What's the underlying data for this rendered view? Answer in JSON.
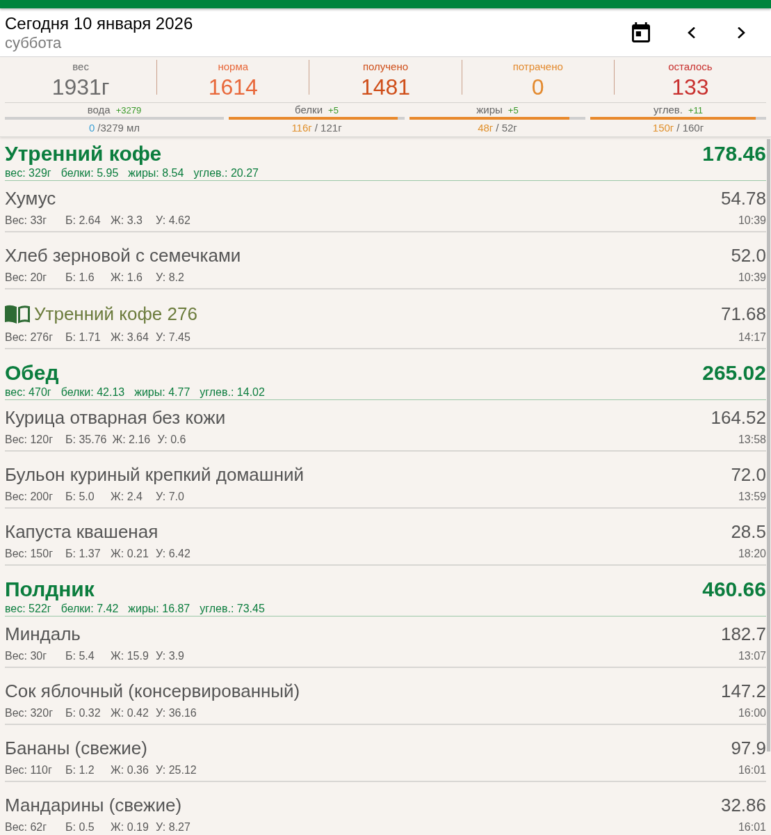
{
  "header": {
    "title": "Сегодня 10 января 2026",
    "weekday": "суббота"
  },
  "summary": [
    {
      "label": "вес",
      "value": "1931г",
      "color": "#6b6b6b"
    },
    {
      "label": "норма",
      "value": "1614",
      "color": "#e8683a"
    },
    {
      "label": "получено",
      "value": "1481",
      "color": "#cf4f1a"
    },
    {
      "label": "потрачено",
      "value": "0",
      "color": "#e38a2e"
    },
    {
      "label": "осталось",
      "value": "133",
      "color": "#c8302e"
    }
  ],
  "macros": [
    {
      "label": "вода",
      "delta": "+3279",
      "eaten": "0",
      "total": "/3279 мл",
      "color": "#3a9fd5"
    },
    {
      "label": "белки",
      "delta": "+5",
      "level": 0.96,
      "eaten": "116г",
      "total": "/ 121г",
      "color": "#e0902c"
    },
    {
      "label": "жиры",
      "delta": "+5",
      "level": 0.91,
      "eaten": "48г",
      "total": "/ 52г",
      "color": "#e0902c"
    },
    {
      "label": "углев.",
      "delta": "+11",
      "level": 0.94,
      "eaten": "150г",
      "total": "/ 160г",
      "color": "#e0902c"
    }
  ],
  "meals": [
    {
      "title": "Утренний кофе",
      "kcal": "178.46",
      "summary": [
        "вес: 329г",
        "белки: 5.95",
        "жиры: 8.54",
        "углев.: 20.27"
      ],
      "items": [
        {
          "kind": "food",
          "name": "Хумус",
          "kcal": "54.78",
          "stats": [
            "Вес: 33г",
            "Б: 2.64",
            "Ж: 3.3",
            "У: 4.62"
          ],
          "time": "10:39"
        },
        {
          "kind": "food",
          "name": "Хлеб зерновой с семечками",
          "kcal": "52.0",
          "stats": [
            "Вес: 20г",
            "Б: 1.6",
            "Ж: 1.6",
            "У: 8.2"
          ],
          "time": "10:39"
        },
        {
          "kind": "recipe",
          "name": "Утренний кофе 276",
          "kcal": "71.68",
          "stats": [
            "Вес: 276г",
            "Б: 1.71",
            "Ж: 3.64",
            "У: 7.45"
          ],
          "time": "14:17"
        }
      ]
    },
    {
      "title": "Обед",
      "kcal": "265.02",
      "summary": [
        "вес: 470г",
        "белки: 42.13",
        "жиры: 4.77",
        "углев.: 14.02"
      ],
      "items": [
        {
          "kind": "food",
          "name": "Курица отварная без кожи",
          "kcal": "164.52",
          "stats": [
            "Вес: 120г",
            "Б: 35.76",
            "Ж: 2.16",
            "У: 0.6"
          ],
          "time": "13:58"
        },
        {
          "kind": "food",
          "name": "Бульон куриный крепкий домашний",
          "kcal": "72.0",
          "stats": [
            "Вес: 200г",
            "Б: 5.0",
            "Ж: 2.4",
            "У: 7.0"
          ],
          "time": "13:59"
        },
        {
          "kind": "food",
          "name": "Капуста квашеная",
          "kcal": "28.5",
          "stats": [
            "Вес: 150г",
            "Б: 1.37",
            "Ж: 0.21",
            "У: 6.42"
          ],
          "time": "18:20"
        }
      ]
    },
    {
      "title": "Полдник",
      "kcal": "460.66",
      "summary": [
        "вес: 522г",
        "белки: 7.42",
        "жиры: 16.87",
        "углев.: 73.45"
      ],
      "items": [
        {
          "kind": "food",
          "name": "Миндаль",
          "kcal": "182.7",
          "stats": [
            "Вес: 30г",
            "Б: 5.4",
            "Ж: 15.9",
            "У: 3.9"
          ],
          "time": "13:07"
        },
        {
          "kind": "food",
          "name": "Сок яблочный (консервированный)",
          "kcal": "147.2",
          "stats": [
            "Вес: 320г",
            "Б: 0.32",
            "Ж: 0.42",
            "У: 36.16"
          ],
          "time": "16:00"
        },
        {
          "kind": "food",
          "name": "Бананы (свежие)",
          "kcal": "97.9",
          "stats": [
            "Вес: 110г",
            "Б: 1.2",
            "Ж: 0.36",
            "У: 25.12"
          ],
          "time": "16:01"
        },
        {
          "kind": "food",
          "name": "Мандарины (свежие)",
          "kcal": "32.86",
          "stats": [
            "Вес: 62г",
            "Б: 0.5",
            "Ж: 0.19",
            "У: 8.27"
          ],
          "time": "16:01"
        }
      ]
    }
  ]
}
